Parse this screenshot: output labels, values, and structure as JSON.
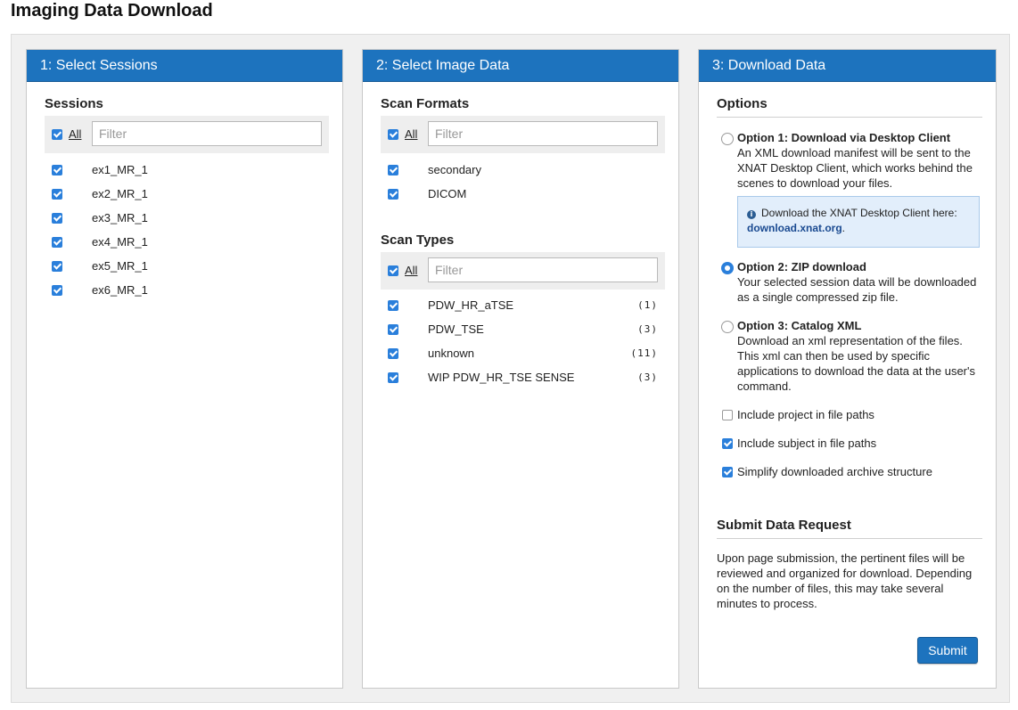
{
  "page_title": "Imaging Data Download",
  "panel1": {
    "header": "1: Select Sessions",
    "section_title": "Sessions",
    "all_label": "All",
    "filter_placeholder": "Filter",
    "sessions": [
      {
        "label": "ex1_MR_1",
        "checked": true
      },
      {
        "label": "ex2_MR_1",
        "checked": true
      },
      {
        "label": "ex3_MR_1",
        "checked": true
      },
      {
        "label": "ex4_MR_1",
        "checked": true
      },
      {
        "label": "ex5_MR_1",
        "checked": true
      },
      {
        "label": "ex6_MR_1",
        "checked": true
      }
    ]
  },
  "panel2": {
    "header": "2: Select Image Data",
    "formats_title": "Scan Formats",
    "formats_all_label": "All",
    "formats_filter_placeholder": "Filter",
    "formats": [
      {
        "label": "secondary",
        "checked": true
      },
      {
        "label": "DICOM",
        "checked": true
      }
    ],
    "types_title": "Scan Types",
    "types_all_label": "All",
    "types_filter_placeholder": "Filter",
    "types": [
      {
        "label": "PDW_HR_aTSE",
        "count": "(1)",
        "checked": true
      },
      {
        "label": "PDW_TSE",
        "count": "(3)",
        "checked": true
      },
      {
        "label": "unknown",
        "count": "(11)",
        "checked": true
      },
      {
        "label": "WIP PDW_HR_TSE SENSE",
        "count": "(3)",
        "checked": true
      }
    ]
  },
  "panel3": {
    "header": "3: Download Data",
    "options_title": "Options",
    "option1": {
      "title": "Option 1: Download via Desktop Client",
      "desc": "An XML download manifest will be sent to the XNAT Desktop Client, which works behind the scenes to download your files.",
      "selected": false,
      "info_text": "Download the XNAT Desktop Client here:",
      "info_link": "download.xnat.org",
      "info_link_suffix": "."
    },
    "option2": {
      "title": "Option 2: ZIP download",
      "desc": "Your selected session data will be downloaded as a single compressed zip file.",
      "selected": true
    },
    "option3": {
      "title": "Option 3: Catalog XML",
      "desc": "Download an xml representation of the files. This xml can then be used by specific applications to download the data at the user's command.",
      "selected": false
    },
    "include_project": {
      "label": "Include project in file paths",
      "checked": false
    },
    "include_subject": {
      "label": "Include subject in file paths",
      "checked": true
    },
    "simplify": {
      "label": "Simplify downloaded archive structure",
      "checked": true
    },
    "submit_title": "Submit Data Request",
    "submit_text": "Upon page submission, the pertinent files will be reviewed and organized for download. Depending on the number of files, this may take several minutes to process.",
    "submit_label": "Submit"
  },
  "colors": {
    "header_blue": "#1d73be",
    "checkbox_blue": "#2a7fdb",
    "info_bg": "#e2eefb",
    "link_blue": "#1a4a91"
  }
}
